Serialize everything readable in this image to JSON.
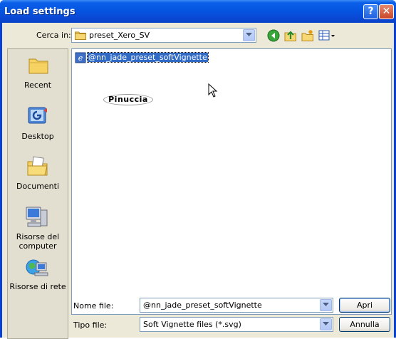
{
  "window": {
    "title": "Load settings",
    "help_label": "?",
    "close_label": "✕"
  },
  "location": {
    "label": "Cerca in:",
    "value": "preset_Xero_SV"
  },
  "toolbar": {
    "icons": [
      "back-icon",
      "up-folder-icon",
      "new-folder-icon",
      "view-menu-icon"
    ]
  },
  "places": [
    {
      "label": "Recent",
      "icon": "recent-folder-icon"
    },
    {
      "label": "Desktop",
      "icon": "desktop-icon"
    },
    {
      "label": "Documenti",
      "icon": "documents-folder-icon"
    },
    {
      "label": "Risorse del computer",
      "icon": "computer-icon"
    },
    {
      "label": "Risorse di rete",
      "icon": "network-icon"
    }
  ],
  "files": [
    {
      "name": "@nn_jade_preset_softVignette",
      "selected": true,
      "icon": "svg-file-icon"
    }
  ],
  "watermark": "Pinuccia",
  "filename": {
    "label": "Nome file:",
    "value": "@nn_jade_preset_softVignette"
  },
  "filetype": {
    "label": "Tipo file:",
    "value": "Soft Vignette files (*.svg)"
  },
  "buttons": {
    "open": "Apri",
    "cancel": "Annulla"
  },
  "colors": {
    "titlebar": "#0554e0",
    "client": "#ece9d8",
    "selection": "#316ac5"
  }
}
